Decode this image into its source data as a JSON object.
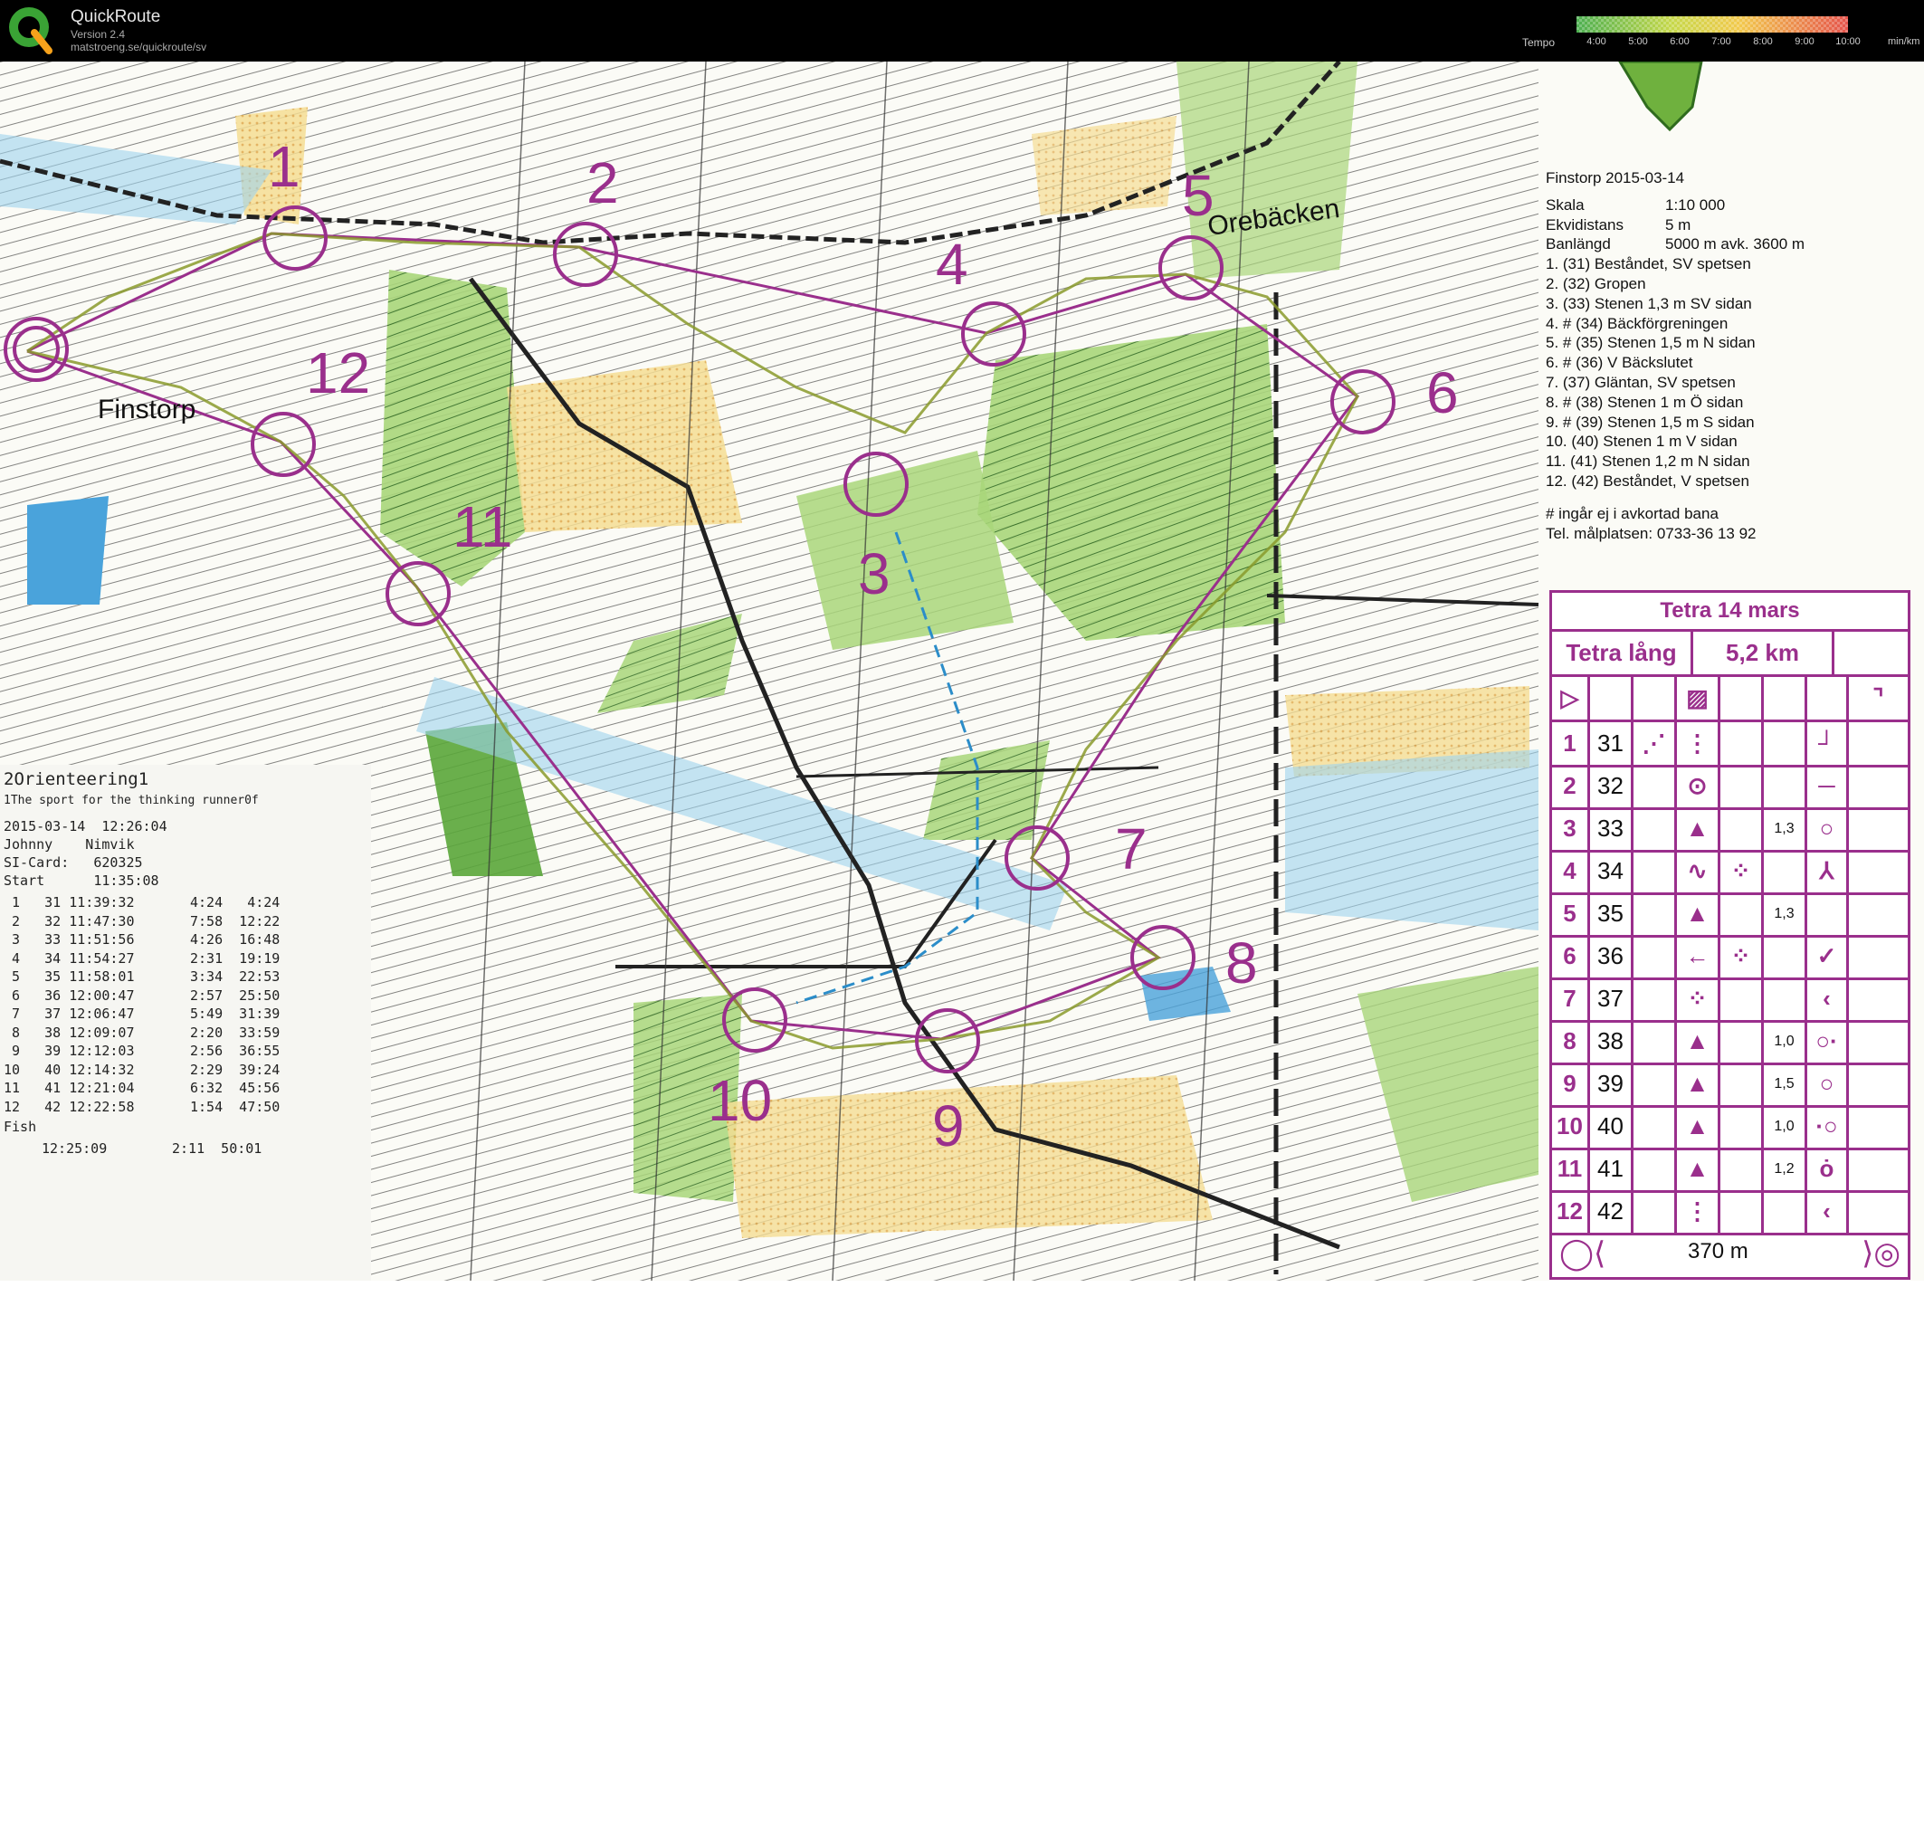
{
  "app": {
    "title": "QuickRoute",
    "version": "Version 2.4",
    "url": "matstroeng.se/quickroute/sv",
    "tempo_label": "Tempo",
    "tempo_ticks": [
      "4:00",
      "5:00",
      "6:00",
      "7:00",
      "8:00",
      "9:00",
      "10:00"
    ],
    "tempo_unit": "min/km"
  },
  "map": {
    "control_numbers": [
      "1",
      "2",
      "3",
      "4",
      "5",
      "6",
      "7",
      "8",
      "9",
      "10",
      "11",
      "12"
    ],
    "place_names": [
      "Finstorp",
      "Orebäcken"
    ]
  },
  "legend": {
    "event": "Finstorp 2015-03-14",
    "scale_label": "Skala",
    "scale_value": "1:10 000",
    "contour_label": "Ekvidistans",
    "contour_value": "5 m",
    "length_label": "Banlängd",
    "length_value": "5000 m avk. 3600 m",
    "controls": [
      "1.    (31) Beståndet, SV spetsen",
      "2.    (32) Gropen",
      "3.    (33) Stenen 1,3 m SV sidan",
      "4. #  (34) Bäckförgreningen",
      "5. #  (35) Stenen 1,5 m N sidan",
      "6. #  (36) V Bäckslutet",
      "7.    (37) Gläntan, SV spetsen",
      "8. #  (38) Stenen 1 m Ö sidan",
      "9. #  (39) Stenen 1,5 m S sidan",
      "10.   (40) Stenen 1 m V sidan",
      "11.   (41) Stenen 1,2 m N sidan",
      "12.   (42) Beståndet, V spetsen"
    ],
    "note": "# ingår ej i avkortad bana",
    "phone": "Tel. målplatsen: 0733-36 13 92"
  },
  "description_sheet": {
    "title": "Tetra 14 mars",
    "course": "Tetra lång",
    "length": "5,2 km",
    "rows": [
      {
        "n": "1",
        "code": "31",
        "size": ""
      },
      {
        "n": "2",
        "code": "32",
        "size": ""
      },
      {
        "n": "3",
        "code": "33",
        "size": "1,3"
      },
      {
        "n": "4",
        "code": "34",
        "size": ""
      },
      {
        "n": "5",
        "code": "35",
        "size": "1,3"
      },
      {
        "n": "6",
        "code": "36",
        "size": ""
      },
      {
        "n": "7",
        "code": "37",
        "size": ""
      },
      {
        "n": "8",
        "code": "38",
        "size": "1,0"
      },
      {
        "n": "9",
        "code": "39",
        "size": "1,5"
      },
      {
        "n": "10",
        "code": "40",
        "size": "1,0"
      },
      {
        "n": "11",
        "code": "41",
        "size": "1,2"
      },
      {
        "n": "12",
        "code": "42",
        "size": ""
      }
    ],
    "finish": "370 m"
  },
  "receipt": {
    "header1": "2Orienteering1",
    "header2": "1The sport for the thinking runner0f",
    "date": "2015-03-14  12:26:04",
    "name": "Johnny    Nimvik",
    "card": "SI-Card:   620325",
    "start": "Start      11:35:08",
    "splits": [
      " 1   31 11:39:32",
      " 2   32 11:47:30",
      " 3   33 11:51:56",
      " 4   34 11:54:27",
      " 5   35 11:58:01",
      " 6   36 12:00:47",
      " 7   37 12:06:47",
      " 8   38 12:09:07",
      " 9   39 12:12:03",
      "10   40 12:14:32",
      "11   41 12:21:04",
      "12   42 12:22:58"
    ],
    "times": [
      "4:24   4:24",
      "7:58  12:22",
      "4:26  16:48",
      "2:31  19:19",
      "3:34  22:53",
      "2:57  25:50",
      "5:49  31:39",
      "2:20  33:59",
      "2:56  36:55",
      "2:29  39:24",
      "6:32  45:56",
      "1:54  47:50"
    ],
    "finish_label": "Fish",
    "finish_time": "12:25:09",
    "finish_split": "2:11  50:01"
  },
  "colors": {
    "course": "#9a2f8c",
    "forest_green": "#7bc043",
    "open_yellow": "#f2d98a",
    "water_blue": "#6fb9e0"
  }
}
